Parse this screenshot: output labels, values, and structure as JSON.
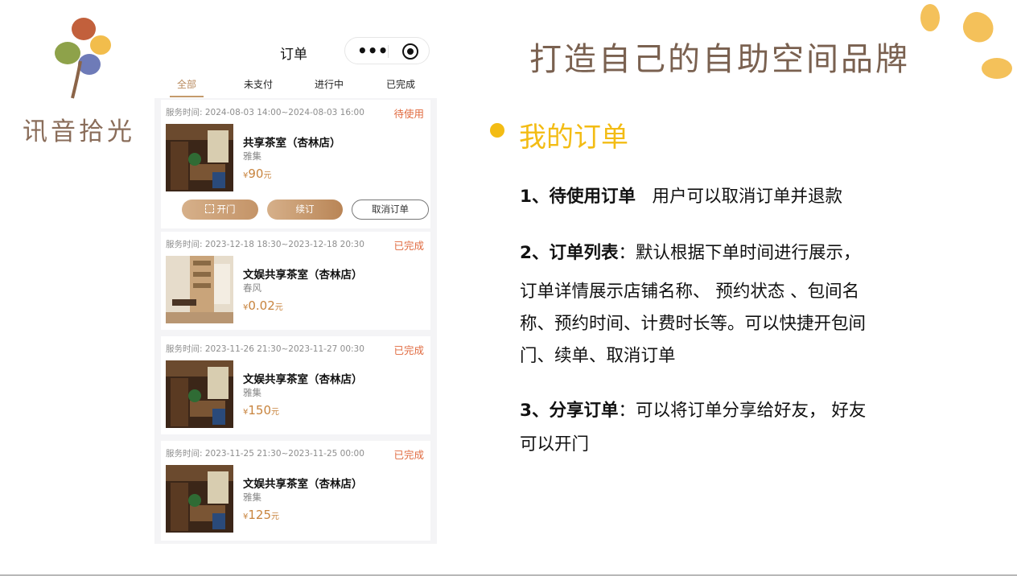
{
  "brand": {
    "name": "讯音拾光"
  },
  "headline": "打造自己的自助空间品牌",
  "phone": {
    "title": "订单",
    "tabs": [
      "全部",
      "未支付",
      "进行中",
      "已完成"
    ],
    "currency_symbol": "¥",
    "price_unit": "元",
    "buttons": {
      "open": "开门",
      "renew": "续订",
      "cancel": "取消订单"
    },
    "orders": [
      {
        "service_time": "服务时间: 2024-08-03 14:00~2024-08-03 16:00",
        "status": "待使用",
        "store": "共享茶室（杏林店）",
        "room": "雅集",
        "price": "90"
      },
      {
        "service_time": "服务时间: 2023-12-18 18:30~2023-12-18 20:30",
        "status": "已完成",
        "store": "文娱共享茶室（杏林店）",
        "room": "春风",
        "price": "0.02"
      },
      {
        "service_time": "服务时间: 2023-11-26 21:30~2023-11-27 00:30",
        "status": "已完成",
        "store": "文娱共享茶室（杏林店）",
        "room": "雅集",
        "price": "150"
      },
      {
        "service_time": "服务时间: 2023-11-25 21:30~2023-11-25 00:00",
        "status": "已完成",
        "store": "文娱共享茶室（杏林店）",
        "room": "雅集",
        "price": "125"
      }
    ]
  },
  "content": {
    "section_title": "我的订单",
    "items": [
      {
        "title": "1、待使用订单",
        "lines": [
          "用户可以取消订单并退款"
        ]
      },
      {
        "title": "2、订单列表",
        "sep": "：",
        "lines": [
          "默认根据下单时间进行展示，",
          "订单详情展示店铺名称、 预约状态 、包间名",
          "称、预约时间、计费时长等。可以快捷开包间",
          "门、续单、取消订单"
        ]
      },
      {
        "title": "3、分享订单",
        "sep": "：",
        "lines": [
          "可以将订单分享给好友， 好友",
          "可以开门"
        ]
      }
    ]
  },
  "colors": {
    "accent_yellow": "#f3bc14",
    "status_orange": "#e06a3f",
    "price_gold": "#c8843e",
    "brand_brown": "#7a6150"
  }
}
